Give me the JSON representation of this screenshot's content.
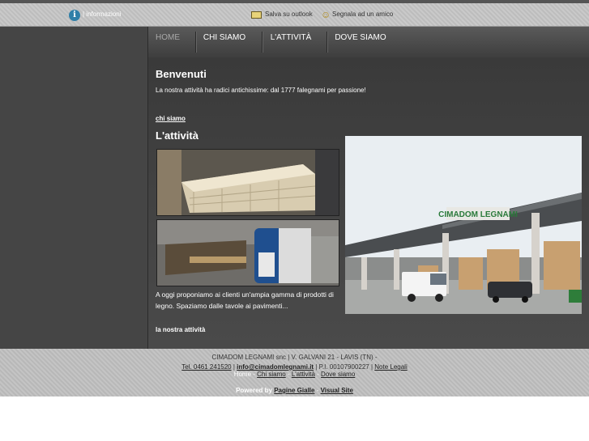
{
  "topbar": {
    "info_label": "| informazioni",
    "outlook_label": "Salva su outlook",
    "friend_label": "Segnala ad un amico"
  },
  "nav": {
    "items": [
      {
        "label": "HOME"
      },
      {
        "label": "CHI SIAMO"
      },
      {
        "label": "L'ATTIVITÀ"
      },
      {
        "label": "DOVE SIAMO"
      }
    ]
  },
  "content": {
    "welcome_title": "Benvenuti",
    "welcome_text": "La nostra attività ha radici antichissime: dal 1777 falegnami per passione!",
    "chi_link": "chi siamo",
    "activity_title": "L'attività",
    "activity_text": "A oggi proponiamo ai clienti un'ampia gamma di prodotti di legno. Spaziamo dalle tavole ai pavimenti...",
    "activity_link": "la nostra attività",
    "sign_text": "CIMADOM LEGNAMI"
  },
  "footer": {
    "company": "CIMADOM LEGNAMI snc | V. GALVANI 21 - LAVIS (TN) -",
    "tel": "Tel. 0461 241520",
    "sep1": " | ",
    "email": "info@cimadomlegnami.it",
    "piva": " | P.I. 00107900227 | ",
    "legal": "Note Legali",
    "links": [
      "Home",
      "Chi siamo",
      "L'attività",
      "Dove siamo"
    ],
    "link_sep": " - ",
    "powered": "Powered by",
    "pg": "Pagine Gialle",
    "dash": " - ",
    "vs": "Visual Site"
  }
}
